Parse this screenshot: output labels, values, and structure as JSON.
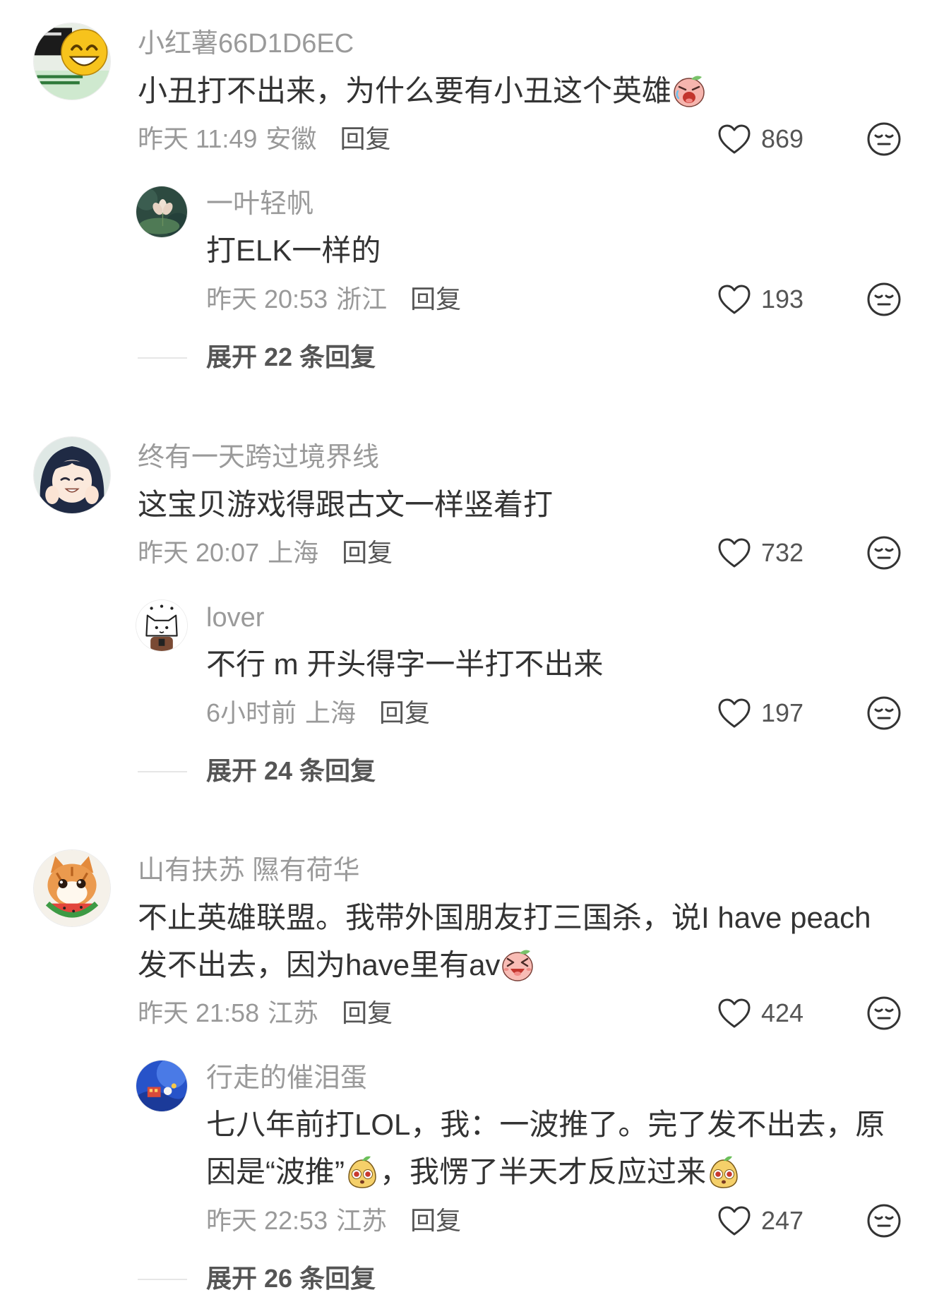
{
  "colors": {
    "username": "#9a9a9a",
    "text": "#333333",
    "meta": "#999999",
    "action": "#555555",
    "divider": "#e6e6e6"
  },
  "icons": {
    "like": "heart-icon",
    "dislike": "dislike-face-icon"
  },
  "comments": [
    {
      "username": "小红薯66D1D6EC",
      "content": [
        "小丑打不出来，为什么要有小丑这个英雄"
      ],
      "emojis": [
        "crying-face-emoji"
      ],
      "time": "昨天 11:49",
      "location": "安徽",
      "reply_label": "回复",
      "likes": "869",
      "reply": {
        "username": "一叶轻帆",
        "content": [
          "打ELK一样的"
        ],
        "time": "昨天 20:53",
        "location": "浙江",
        "reply_label": "回复",
        "likes": "193"
      },
      "expand_label": "展开 22 条回复"
    },
    {
      "username": "终有一天跨过境界线",
      "content": [
        "这宝贝游戏得跟古文一样竖着打"
      ],
      "time": "昨天 20:07",
      "location": "上海",
      "reply_label": "回复",
      "likes": "732",
      "reply": {
        "username": "lover",
        "content": [
          "不行 m 开头得字一半打不出来"
        ],
        "time": "6小时前",
        "location": "上海",
        "reply_label": "回复",
        "likes": "197"
      },
      "expand_label": "展开 24 条回复"
    },
    {
      "username": "山有扶苏 隰有荷华",
      "content": [
        "不止英雄联盟。我带外国朋友打三国杀，说I have peach",
        "发不出去，因为have里有av"
      ],
      "emojis": [
        "laughing-squint-emoji"
      ],
      "time": "昨天 21:58",
      "location": "江苏",
      "reply_label": "回复",
      "likes": "424",
      "reply": {
        "username": "行走的催泪蛋",
        "content": [
          "七八年前打LOL，我：一波推了。完了发不出去，原",
          "因是“波推”",
          "，我愣了半天才反应过来"
        ],
        "emojis": [
          "shocked-pear-emoji",
          "shocked-pear-emoji"
        ],
        "time": "昨天 22:53",
        "location": "江苏",
        "reply_label": "回复",
        "likes": "247"
      },
      "expand_label": "展开 26 条回复"
    }
  ]
}
